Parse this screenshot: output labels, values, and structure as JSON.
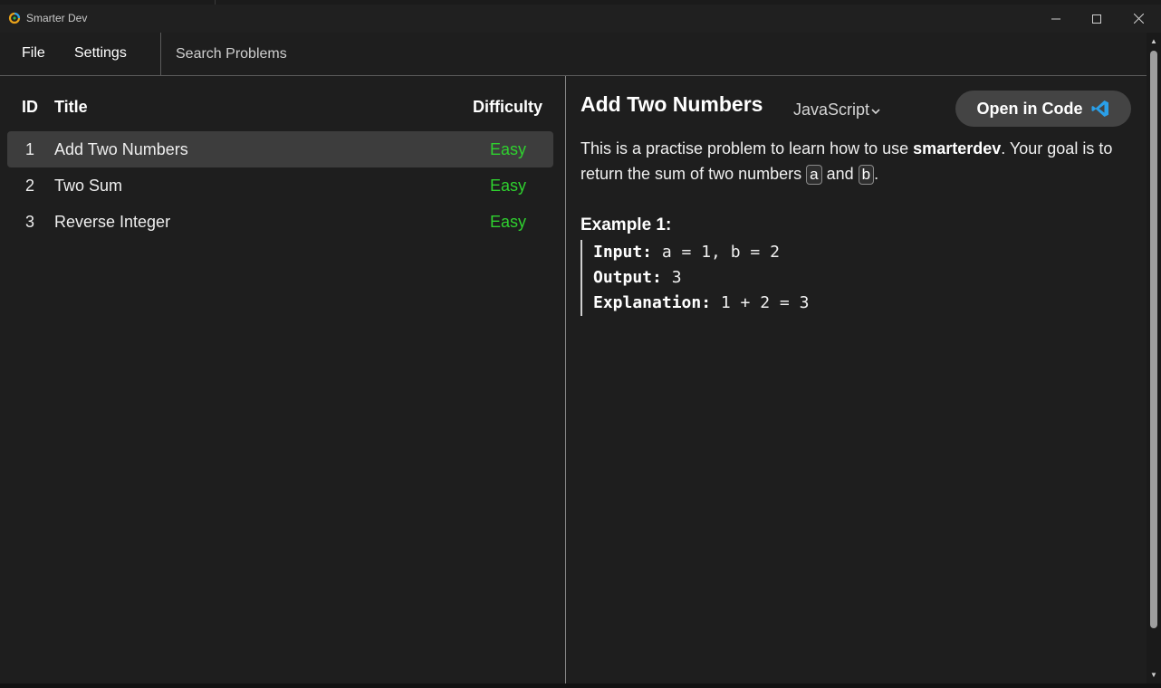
{
  "window": {
    "title": "Smarter Dev",
    "controls": [
      "minimize-icon",
      "maximize-icon",
      "close-icon"
    ]
  },
  "menu": {
    "file": "File",
    "settings": "Settings",
    "search_placeholder": "Search Problems"
  },
  "problem_list": {
    "headers": {
      "id": "ID",
      "title": "Title",
      "difficulty": "Difficulty"
    },
    "rows": [
      {
        "id": "1",
        "title": "Add Two Numbers",
        "difficulty": "Easy"
      },
      {
        "id": "2",
        "title": "Two Sum",
        "difficulty": "Easy"
      },
      {
        "id": "3",
        "title": "Reverse Integer",
        "difficulty": "Easy"
      }
    ]
  },
  "problem": {
    "title": "Add Two Numbers",
    "language": "JavaScript",
    "open_button": "Open in Code",
    "desc_part1": "This is a practise problem to learn how to use ",
    "desc_bold": "smarterdev",
    "desc_part2": ". Your goal is to return the sum of two numbers ",
    "var_a": "a",
    "desc_and": " and ",
    "var_b": "b",
    "desc_end": ".",
    "example_title": "Example 1:",
    "example": {
      "input_label": "Input:",
      "input_value": " a = 1, b = 2",
      "output_label": "Output:",
      "output_value": " 3",
      "explanation_label": "Explanation:",
      "explanation_value": " 1 + 2 = 3"
    }
  },
  "colors": {
    "easy": "#2fd12f",
    "vscode": "#2a9fe8",
    "background": "#1e1e1e",
    "selected_row": "#3d3d3d"
  }
}
